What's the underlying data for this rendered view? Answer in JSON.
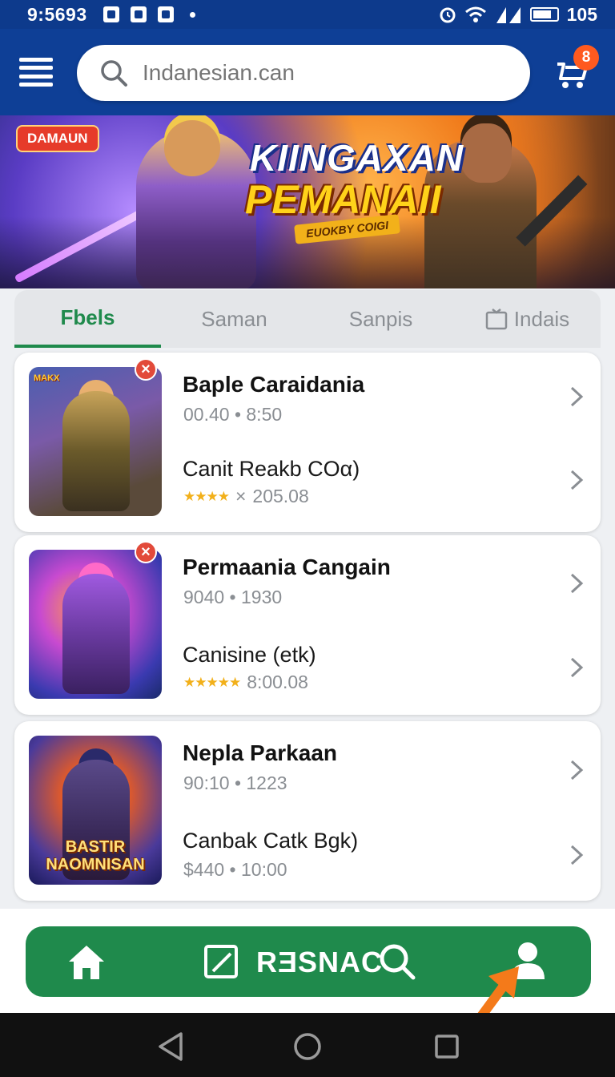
{
  "status_bar": {
    "time": "9:5693",
    "battery": "105"
  },
  "header": {
    "search_placeholder": "Indanesian.can",
    "cart_badge": "8"
  },
  "banner": {
    "tag": "DAMAUN",
    "title_line1": "KIINGAXAN",
    "title_line2": "PEMANAII",
    "subtitle": "EUOKBY COIGI",
    "active_dot": 1,
    "dot_count": 5
  },
  "tabs": [
    {
      "label": "Fbels",
      "active": true
    },
    {
      "label": "Saman",
      "active": false
    },
    {
      "label": "Sanpis",
      "active": false
    },
    {
      "label": "Indais",
      "active": false
    }
  ],
  "cards": [
    {
      "title": "Baple Caraidania",
      "meta": "00.40 • 8:50",
      "subtitle": "Canit Reakb COα)",
      "rating_text": "205.08",
      "rating_prefix": "×",
      "thumb_logo": "MAKX",
      "has_close": true
    },
    {
      "title": "Permaania Cangain",
      "meta": "9040 • 1930",
      "subtitle": "Canisine (etk)",
      "rating_text": "8:00.08",
      "rating_prefix": "",
      "thumb_logo": "",
      "has_close": true
    },
    {
      "title": "Nepla Parkaan",
      "meta": "90:10 • 1223",
      "subtitle": "Canbak Catk Bgk)",
      "rating_text": "$440 • 10:00",
      "rating_prefix": "",
      "thumb_logo": "BASTIR NAOMNISAN",
      "has_close": false
    }
  ],
  "bottom_nav": {
    "label": "RƎSNAC"
  },
  "colors": {
    "header_blue": "#0e3f96",
    "accent_green": "#1f8a4c",
    "badge_orange": "#ff5a1f",
    "close_red": "#e24a3a",
    "star_gold": "#f2b01a"
  },
  "icons": [
    "menu-icon",
    "search-icon",
    "cart-icon",
    "chevron-right-icon",
    "home-icon",
    "edit-icon",
    "profile-icon",
    "back-icon",
    "circle-home-icon",
    "recent-apps-icon"
  ]
}
